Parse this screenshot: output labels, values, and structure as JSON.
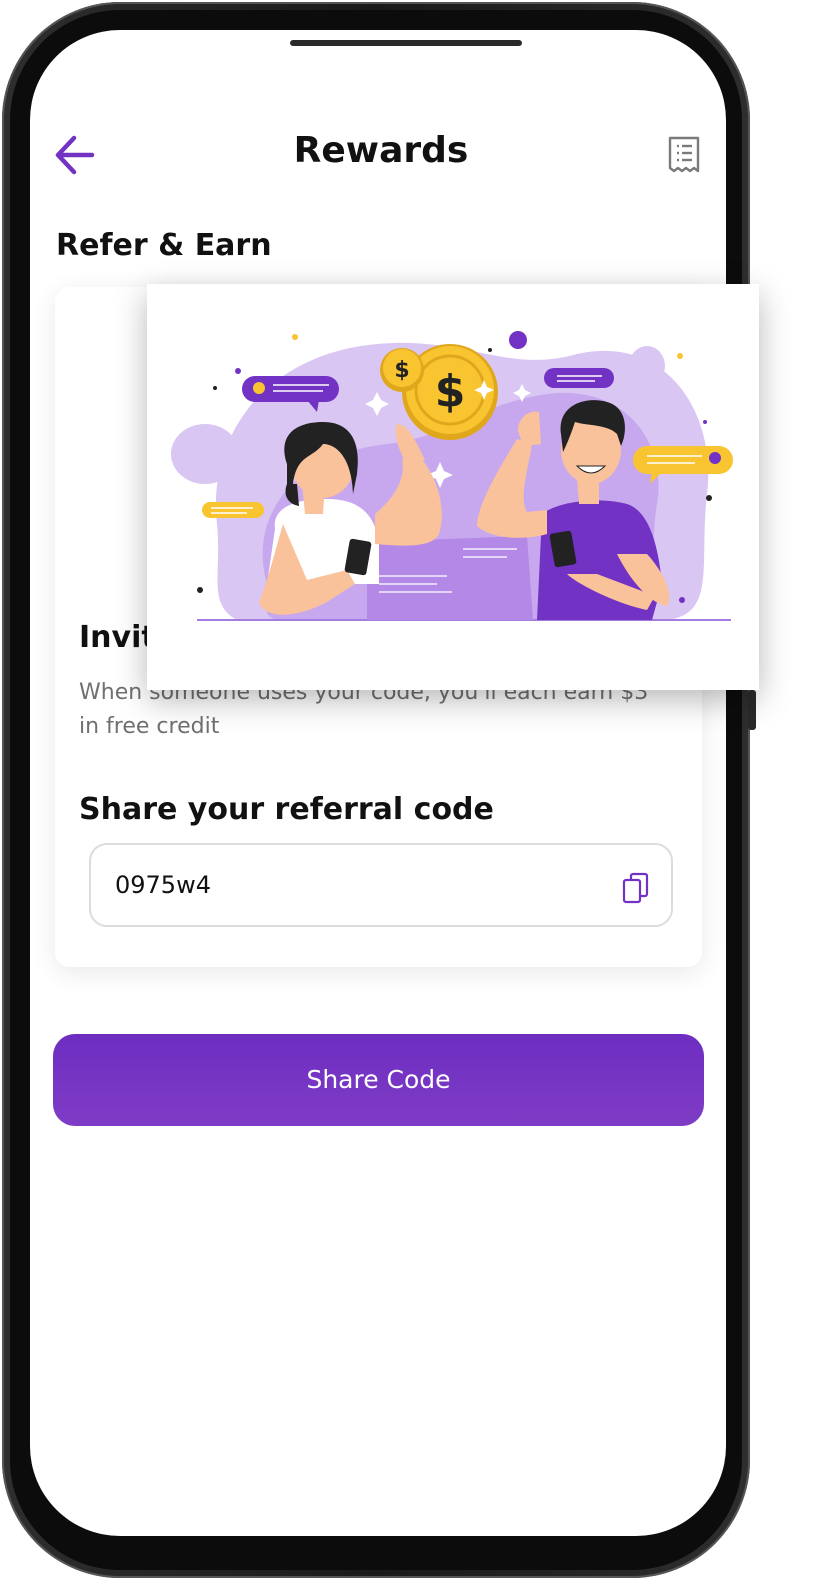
{
  "header": {
    "title": "Rewards"
  },
  "refer": {
    "section_title": "Refer & Earn",
    "invite_title": "Invite friends",
    "invite_description": "When someone uses your code, you'll each earn $3 in free credit",
    "code_title": "Share your referral code",
    "referral_code": "0975w4"
  },
  "actions": {
    "share_label": "Share Code"
  },
  "colors": {
    "accent": "#7233c4",
    "coin": "#f8c531",
    "illustration_light": "#d9c6f3",
    "illustration_mid": "#b488e6"
  },
  "icons": {
    "back": "arrow-left-icon",
    "receipt": "receipt-icon",
    "copy": "copy-icon"
  }
}
